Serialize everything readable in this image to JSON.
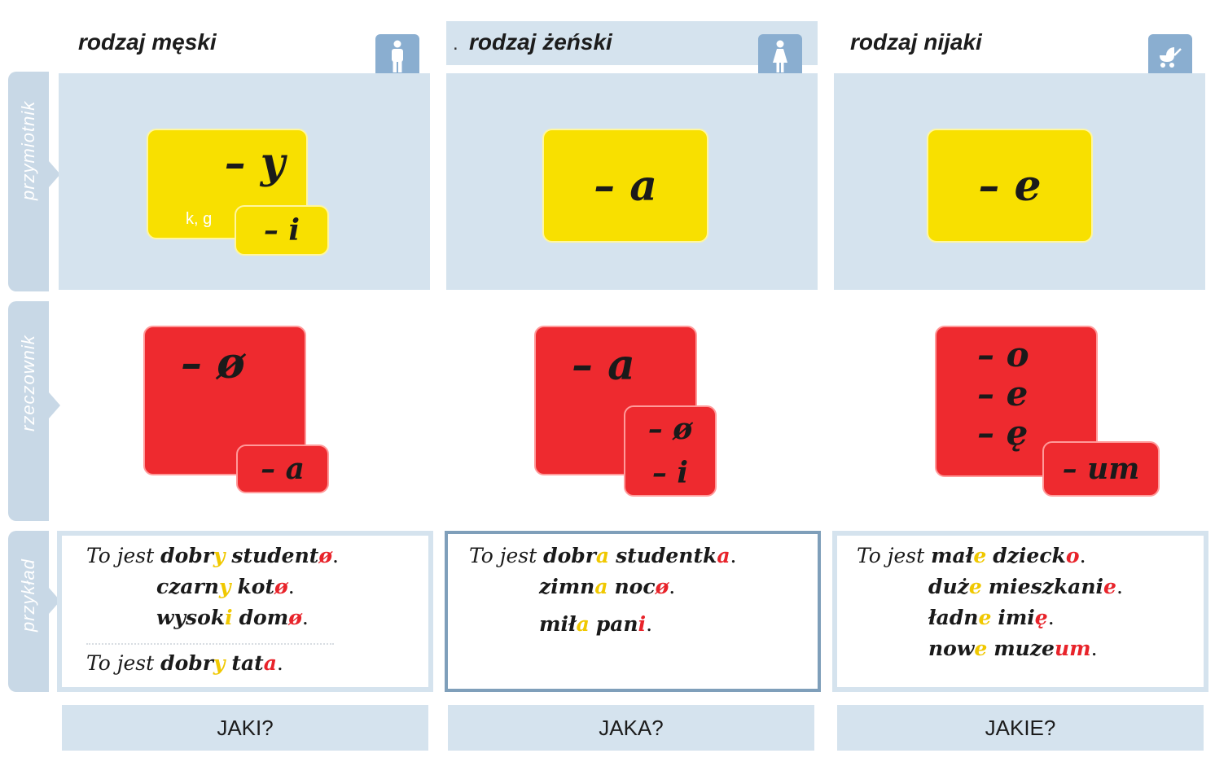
{
  "columns": [
    {
      "title": "rodzaj męski",
      "icon": "man-icon",
      "adjective_main": "– y",
      "adjective_note": "k, g",
      "adjective_alt": "– i",
      "noun_main": "– ø",
      "noun_alt": "– a",
      "question": "JAKI?"
    },
    {
      "title": "rodzaj żeński",
      "title_prefix": ".",
      "icon": "woman-icon",
      "adjective_main": "– a",
      "noun_main": "– a",
      "noun_alt_1": "– ø",
      "noun_alt_2": "– i",
      "question": "JAKA?"
    },
    {
      "title": "rodzaj nijaki",
      "icon": "baby-carriage-icon",
      "adjective_main": "– e",
      "noun_main_1": "– o",
      "noun_main_2": "– e",
      "noun_main_3": "– ę",
      "noun_alt": "– um",
      "question": "JAKIE?"
    }
  ],
  "row_labels": {
    "adjective": "przymiotnik",
    "noun": "rzeczownik",
    "example": "przykład"
  },
  "examples": {
    "masculine": {
      "intro": "To jest",
      "line1": {
        "adj_stem": "dobr",
        "adj_end": "y",
        "noun_stem": "student",
        "noun_end": "ø",
        "punct": "."
      },
      "line2": {
        "adj_stem": "czarn",
        "adj_end": "y",
        "noun_stem": "kot",
        "noun_end": "ø",
        "punct": "."
      },
      "line3": {
        "adj_stem": "wysok",
        "adj_end": "i",
        "noun_stem": "dom",
        "noun_end": "ø",
        "punct": "."
      },
      "line4": {
        "adj_stem": "dobr",
        "adj_end": "y",
        "noun_stem": "tat",
        "noun_end": "a",
        "punct": "."
      }
    },
    "feminine": {
      "intro": "To jest",
      "line1": {
        "adj_stem": "dobr",
        "adj_end": "a",
        "noun_stem": "studentk",
        "noun_end": "a",
        "punct": "."
      },
      "line2": {
        "adj_stem": "zimn",
        "adj_end": "a",
        "noun_stem": "noc",
        "noun_end": "ø",
        "punct": "."
      },
      "line3": {
        "adj_stem": "mił",
        "adj_end": "a",
        "noun_stem": "pan",
        "noun_end": "i",
        "punct": "."
      }
    },
    "neuter": {
      "intro": "To jest",
      "line1": {
        "adj_stem": "mał",
        "adj_end": "e",
        "noun_stem": "dzieck",
        "noun_end": "o",
        "punct": "."
      },
      "line2": {
        "adj_stem": "duż",
        "adj_end": "e",
        "noun_stem": "mieszkani",
        "noun_end": "e",
        "punct": "."
      },
      "line3": {
        "adj_stem": "ładn",
        "adj_end": "e",
        "noun_stem": "imi",
        "noun_end": "ę",
        "punct": "."
      },
      "line4": {
        "adj_stem": "now",
        "adj_end": "e",
        "noun_stem": "muze",
        "noun_end": "um",
        "punct": "."
      }
    }
  },
  "colors": {
    "panel_blue": "#d5e3ee",
    "icon_blue": "#8aaed0",
    "adjective_yellow": "#f8e000",
    "noun_red": "#ee2a2f"
  }
}
